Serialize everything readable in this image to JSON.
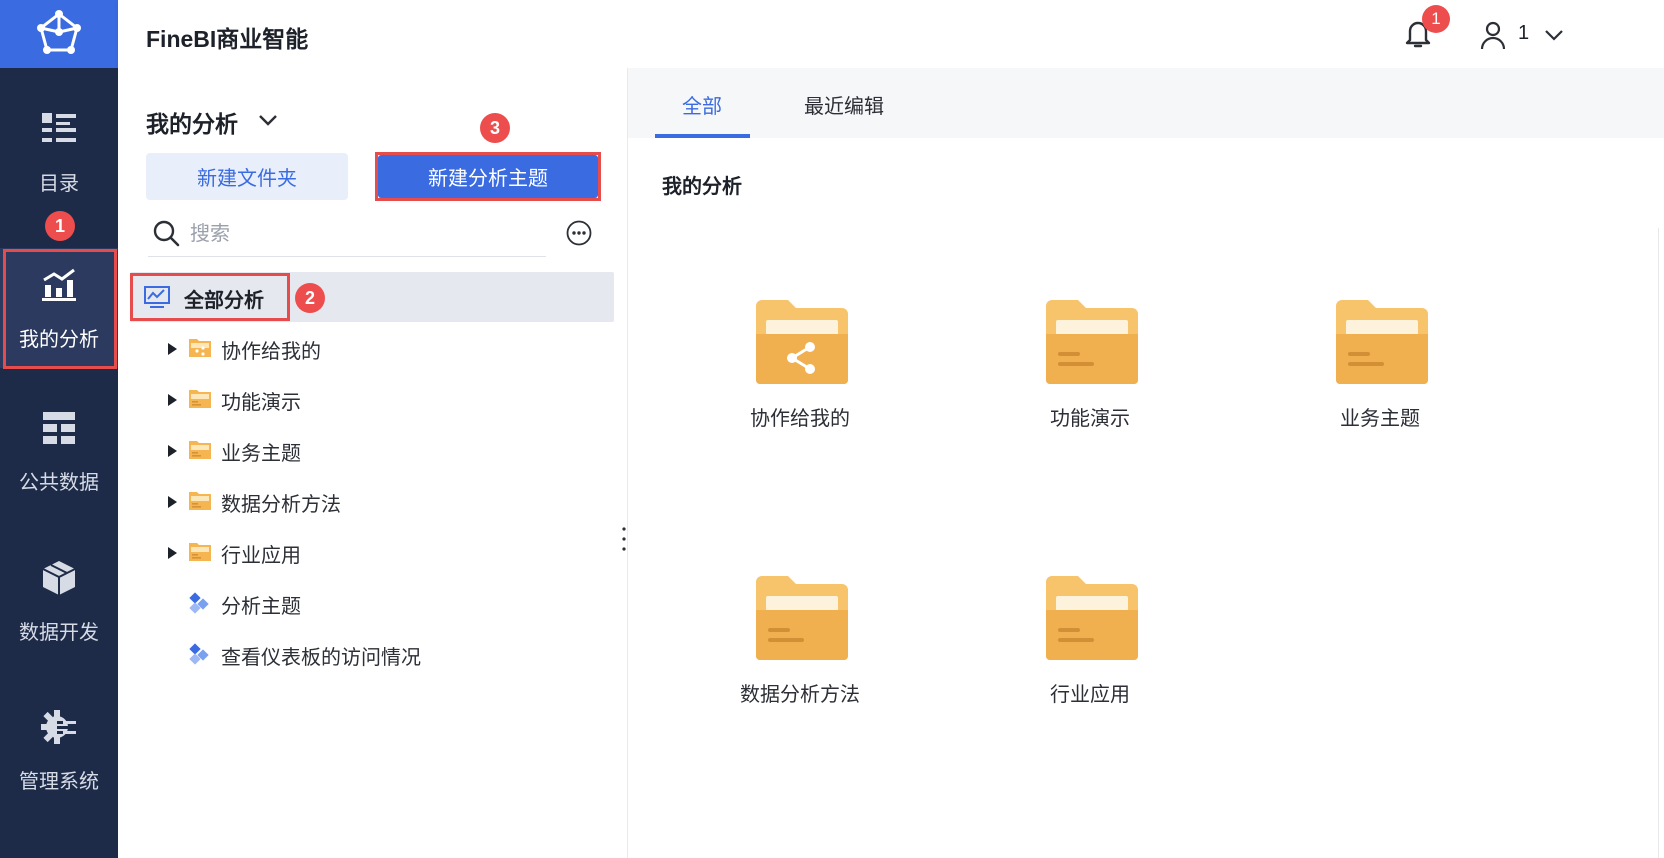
{
  "app": {
    "title": "FineBI商业智能"
  },
  "header": {
    "notification_count": "1",
    "user_name": "1"
  },
  "nav": {
    "items": [
      {
        "label": "目录",
        "icon": "catalog-icon"
      },
      {
        "label": "我的分析",
        "icon": "analysis-chart-icon",
        "active": true
      },
      {
        "label": "公共数据",
        "icon": "public-data-icon"
      },
      {
        "label": "数据开发",
        "icon": "data-dev-icon"
      },
      {
        "label": "管理系统",
        "icon": "gear-icon"
      }
    ]
  },
  "annotations": {
    "step1": "1",
    "step2": "2",
    "step3": "3"
  },
  "panel": {
    "title": "我的分析",
    "new_folder_label": "新建文件夹",
    "new_subject_label": "新建分析主题",
    "search_placeholder": "搜索",
    "root_label": "全部分析",
    "tree": [
      {
        "label": "协作给我的",
        "type": "shared-folder"
      },
      {
        "label": "功能演示",
        "type": "folder"
      },
      {
        "label": "业务主题",
        "type": "folder"
      },
      {
        "label": "数据分析方法",
        "type": "folder"
      },
      {
        "label": "行业应用",
        "type": "folder"
      },
      {
        "label": "分析主题",
        "type": "subject"
      },
      {
        "label": "查看仪表板的访问情况",
        "type": "subject"
      }
    ]
  },
  "content": {
    "tabs": [
      {
        "label": "全部",
        "active": true
      },
      {
        "label": "最近编辑"
      }
    ],
    "section_title": "我的分析",
    "folders": [
      {
        "label": "协作给我的",
        "type": "shared"
      },
      {
        "label": "功能演示",
        "type": "folder"
      },
      {
        "label": "业务主题",
        "type": "folder"
      },
      {
        "label": "数据分析方法",
        "type": "folder"
      },
      {
        "label": "行业应用",
        "type": "folder"
      }
    ]
  },
  "colors": {
    "accent": "#3a6be0",
    "nav_bg": "#1e2b48",
    "highlight": "#e64c4c",
    "folder": "#f5b651"
  }
}
